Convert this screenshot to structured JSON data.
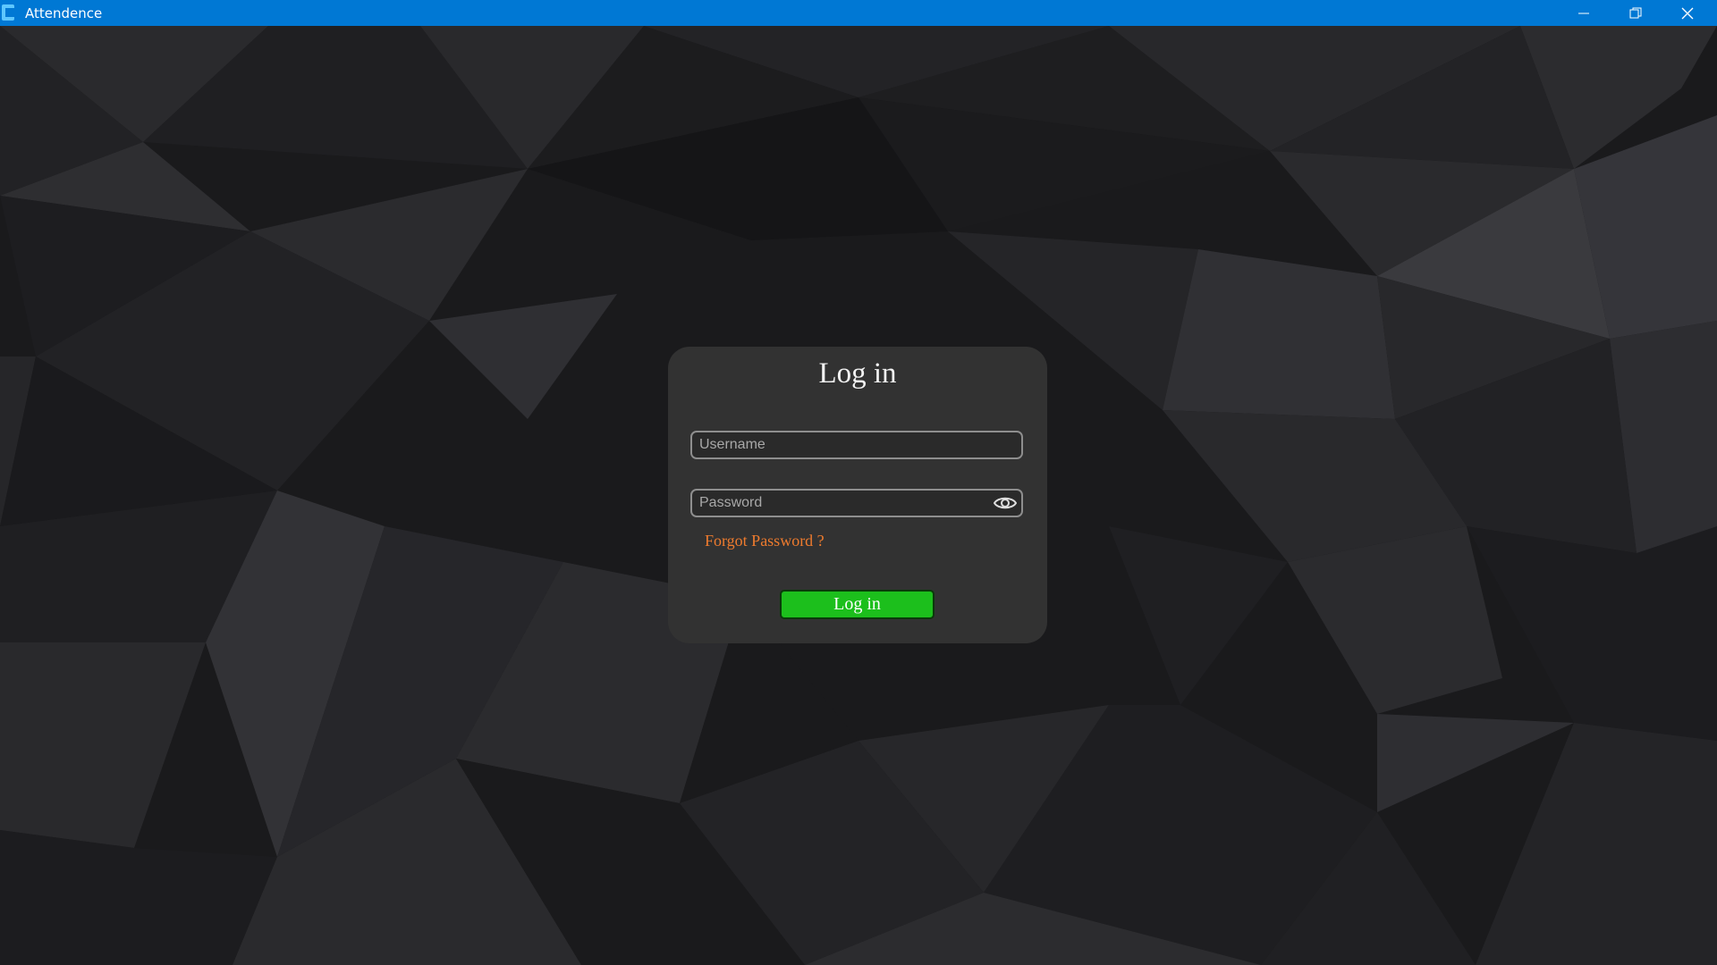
{
  "window": {
    "title": "Attendence",
    "titlebar_color": "#0078d4",
    "controls": {
      "minimize_icon": "minimize-icon",
      "restore_icon": "restore-icon",
      "close_icon": "close-icon"
    }
  },
  "background": {
    "style": "dark low-poly geometric pattern",
    "base_color": "#1a1a1c"
  },
  "login_card": {
    "title": "Log in",
    "username": {
      "placeholder": "Username",
      "value": ""
    },
    "password": {
      "placeholder": "Password",
      "value": "",
      "toggle_icon": "eye-icon"
    },
    "forgot_password": "Forgot Password ?",
    "submit_label": "Log in",
    "colors": {
      "card": "#323232",
      "accent_link": "#ee7b2e",
      "button": "#1cbf1c"
    }
  }
}
